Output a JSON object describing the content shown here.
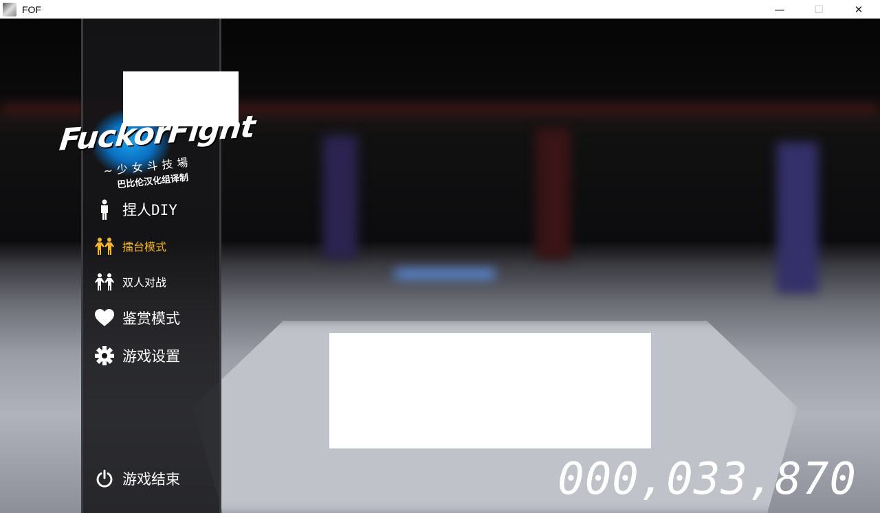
{
  "window": {
    "title": "FOF",
    "minimize": "—",
    "maximize": "☐",
    "close": "✕"
  },
  "logo": {
    "title": "FuckorFight",
    "subtitle": "~少女斗技場",
    "credit": "巴比伦汉化组译制"
  },
  "menu": [
    {
      "label": "捏人DIY",
      "icon": "person-icon",
      "active": false
    },
    {
      "label": "擂台模式",
      "icon": "fighters-icon",
      "active": true
    },
    {
      "label": "双人对战",
      "icon": "fighters-icon",
      "active": false
    },
    {
      "label": "鉴赏模式",
      "icon": "heart-icon",
      "active": false
    },
    {
      "label": "游戏设置",
      "icon": "gear-icon",
      "active": false
    }
  ],
  "exit": {
    "label": "游戏结束",
    "icon": "power-icon"
  },
  "score": "000,033,870",
  "colors": {
    "active": "#f5b62b",
    "sidebar": "#161618"
  }
}
